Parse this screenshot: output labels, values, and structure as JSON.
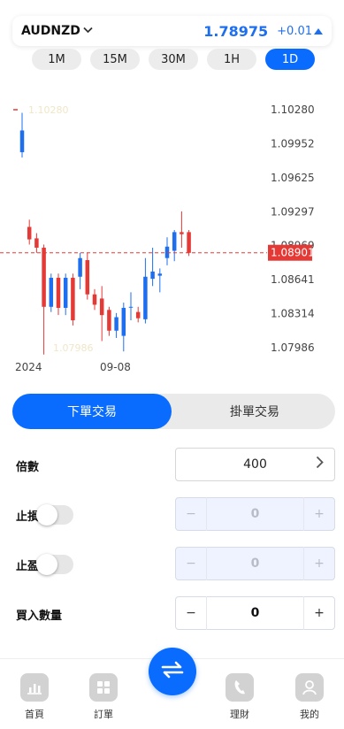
{
  "ticker": {
    "symbol": "AUDNZD",
    "price": "1.78975",
    "change": "+0.01",
    "price_color": "#1e6ff0"
  },
  "timeframes": [
    {
      "label": "1M",
      "active": false
    },
    {
      "label": "15M",
      "active": false
    },
    {
      "label": "30M",
      "active": false
    },
    {
      "label": "1H",
      "active": false
    },
    {
      "label": "1D",
      "active": true
    }
  ],
  "chart_data": {
    "type": "candlestick",
    "title": "",
    "y_ticks": [
      "1.10280",
      "1.09952",
      "1.09625",
      "1.09297",
      "1.08969",
      "1.08641",
      "1.08314",
      "1.07986"
    ],
    "x_ticks": [
      "2024",
      "09-08"
    ],
    "current_price": "1.08901",
    "high_marker": "1.10280",
    "low_marker": "1.07986",
    "ylim": [
      1.07986,
      1.1028
    ],
    "up_color": "#1e6ff0",
    "down_color": "#e53935",
    "candles": [
      {
        "o": 1.0987,
        "c": 1.1008,
        "h": 1.1025,
        "l": 1.0982
      },
      {
        "o": 1.0915,
        "c": 1.0903,
        "h": 1.0922,
        "l": 1.0898
      },
      {
        "o": 1.0904,
        "c": 1.0895,
        "h": 1.0909,
        "l": 1.089
      },
      {
        "o": 1.0895,
        "c": 1.0838,
        "h": 1.0898,
        "l": 1.0792
      },
      {
        "o": 1.0838,
        "c": 1.0866,
        "h": 1.087,
        "l": 1.0833
      },
      {
        "o": 1.0866,
        "c": 1.0837,
        "h": 1.087,
        "l": 1.083
      },
      {
        "o": 1.0837,
        "c": 1.0866,
        "h": 1.087,
        "l": 1.083
      },
      {
        "o": 1.0866,
        "c": 1.0825,
        "h": 1.087,
        "l": 1.082
      },
      {
        "o": 1.0867,
        "c": 1.0885,
        "h": 1.089,
        "l": 1.0855
      },
      {
        "o": 1.0883,
        "c": 1.085,
        "h": 1.089,
        "l": 1.0845
      },
      {
        "o": 1.085,
        "c": 1.084,
        "h": 1.0855,
        "l": 1.0835
      },
      {
        "o": 1.0846,
        "c": 1.083,
        "h": 1.0858,
        "l": 1.0805
      },
      {
        "o": 1.0835,
        "c": 1.0815,
        "h": 1.0838,
        "l": 1.081
      },
      {
        "o": 1.0815,
        "c": 1.0828,
        "h": 1.0832,
        "l": 1.0808
      },
      {
        "o": 1.081,
        "c": 1.0837,
        "h": 1.0842,
        "l": 1.0795
      },
      {
        "o": 1.0838,
        "c": 1.0838,
        "h": 1.0852,
        "l": 1.0825
      },
      {
        "o": 1.0833,
        "c": 1.0827,
        "h": 1.0838,
        "l": 1.0823
      },
      {
        "o": 1.0826,
        "c": 1.0867,
        "h": 1.0885,
        "l": 1.0822
      },
      {
        "o": 1.0865,
        "c": 1.0872,
        "h": 1.0895,
        "l": 1.0858
      },
      {
        "o": 1.0868,
        "c": 1.087,
        "h": 1.0875,
        "l": 1.0852
      },
      {
        "o": 1.0885,
        "c": 1.0896,
        "h": 1.0905,
        "l": 1.0878
      },
      {
        "o": 1.0892,
        "c": 1.091,
        "h": 1.0912,
        "l": 1.0882
      },
      {
        "o": 1.091,
        "c": 1.0908,
        "h": 1.093,
        "l": 1.0895
      },
      {
        "o": 1.091,
        "c": 1.089,
        "h": 1.0912,
        "l": 1.0887
      }
    ]
  },
  "order_tabs": {
    "active": "下單交易",
    "other": "掛單交易"
  },
  "leverage": {
    "label": "倍數",
    "value": "400"
  },
  "stop_loss": {
    "label": "止損",
    "minus": "−",
    "value": "0",
    "plus": "+"
  },
  "take_profit": {
    "label": "止盈",
    "minus": "−",
    "value": "0",
    "plus": "+"
  },
  "buy_qty": {
    "label": "買入數量",
    "minus": "−",
    "value": "0",
    "plus": "+"
  },
  "bottom_nav": [
    {
      "label": "首頁",
      "icon": "chart-icon"
    },
    {
      "label": "訂單",
      "icon": "grid-icon"
    },
    {
      "label": "理財",
      "icon": "phone-icon"
    },
    {
      "label": "我的",
      "icon": "user-icon"
    }
  ],
  "fab": {
    "icon": "swap-arrows-icon"
  }
}
